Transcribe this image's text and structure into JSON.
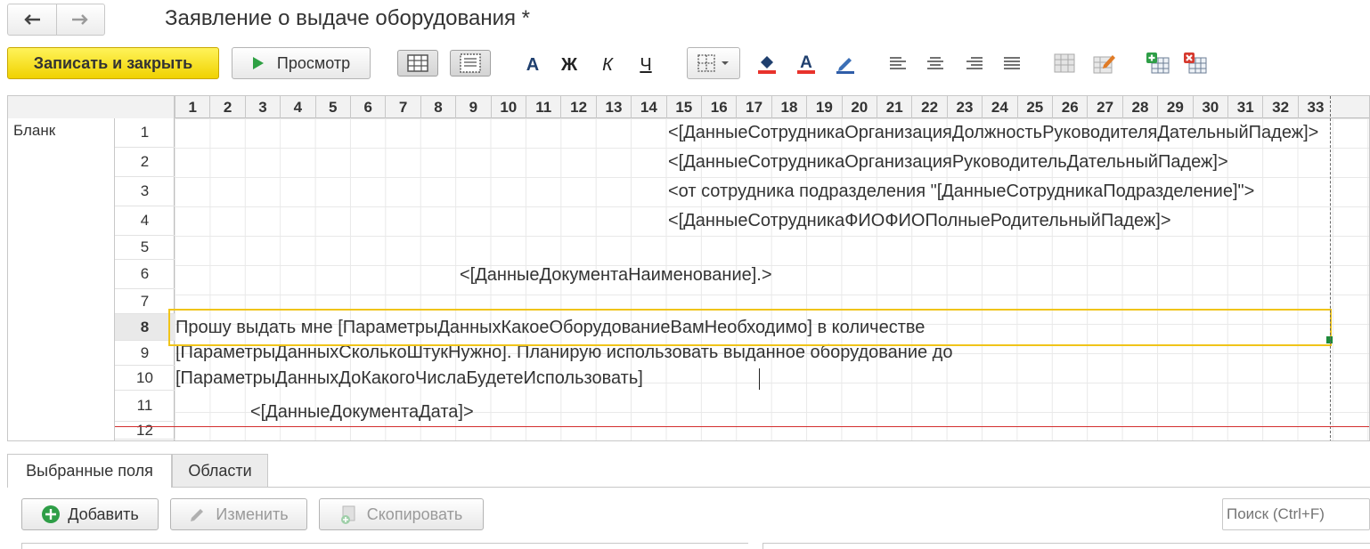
{
  "window": {
    "title": "Заявление о выдаче оборудования *"
  },
  "toolbar": {
    "save_close_label": "Записать и закрыть",
    "preview_label": "Просмотр",
    "bold_label": "Ж",
    "italic_label": "К",
    "underline_label": "Ч",
    "font_label": "A"
  },
  "sheet": {
    "area_label": "Бланк",
    "columns": [
      "1",
      "2",
      "3",
      "4",
      "5",
      "6",
      "7",
      "8",
      "9",
      "10",
      "11",
      "12",
      "13",
      "14",
      "15",
      "16",
      "17",
      "18",
      "19",
      "20",
      "21",
      "22",
      "23",
      "24",
      "25",
      "26",
      "27",
      "28",
      "29",
      "30",
      "31",
      "32",
      "33"
    ],
    "rows": [
      "1",
      "2",
      "3",
      "4",
      "5",
      "6",
      "7",
      "8",
      "9",
      "10",
      "11",
      "12"
    ],
    "active_row": "8",
    "cells": {
      "r1": "<[ДанныеСотрудникаОрганизацияДолжностьРуководителяДательныйПадеж]>",
      "r2": "<[ДанныеСотрудникаОрганизацияРуководительДательныйПадеж]>",
      "r3": "<от сотрудника подразделения \"[ДанныеСотрудникаПодразделение]\">",
      "r4": "<[ДанныеСотрудникаФИОФИОПолныеРодительныйПадеж]>",
      "r6": "<[ДанныеДокументаНаименование].>",
      "r8": "Прошу выдать мне  [ПараметрыДанныхКакоеОборудованиеВамНеобходимо] в количестве",
      "r9": "[ПараметрыДанныхСколькоШтукНужно]. Планирую использовать выданное оборудование до",
      "r10": "[ПараметрыДанныхДоКакогоЧислаБудетеИспользовать]",
      "r11": "<[ДанныеДокументаДата]>"
    }
  },
  "tabs": [
    {
      "label": "Выбранные поля",
      "active": true
    },
    {
      "label": "Области",
      "active": false
    }
  ],
  "fields_toolbar": {
    "add_label": "Добавить",
    "edit_label": "Изменить",
    "copy_label": "Скопировать"
  },
  "search": {
    "placeholder": "Поиск (Ctrl+F)"
  },
  "colors": {
    "primary_button": "#f5dc1e",
    "selection": "#f0c419",
    "page_break_line": "#d32f2f",
    "add_icon": "#2e9e47"
  }
}
